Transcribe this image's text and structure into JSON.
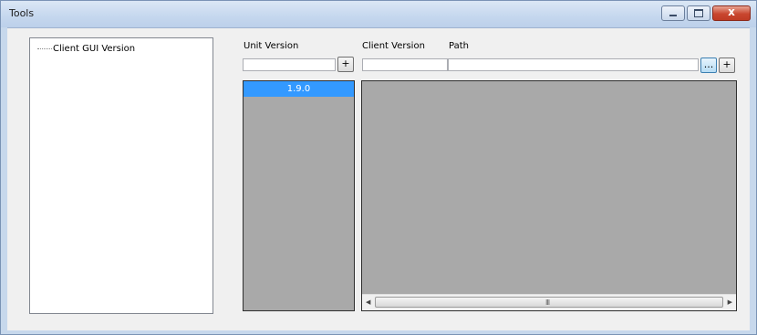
{
  "window": {
    "title": "Tools",
    "close_glyph": "x",
    "icons": {
      "minimize": "minimize-icon",
      "maximize": "maximize-icon",
      "close": "close-icon"
    }
  },
  "tree": {
    "items": [
      {
        "label": "Client GUI Version"
      }
    ]
  },
  "unit_version": {
    "label": "Unit Version",
    "input_value": "",
    "add_label": "+",
    "list": [
      "1.9.0"
    ],
    "selected_color": "#3399ff"
  },
  "client_version": {
    "label": "Client Version",
    "input_value": ""
  },
  "path": {
    "label": "Path",
    "input_value": "",
    "browse_label": "...",
    "add_label": "+"
  },
  "grid": {
    "background": "#a9a9a9",
    "scroll_left": "◀",
    "scroll_right": "▶",
    "thumb_grip": "III"
  }
}
